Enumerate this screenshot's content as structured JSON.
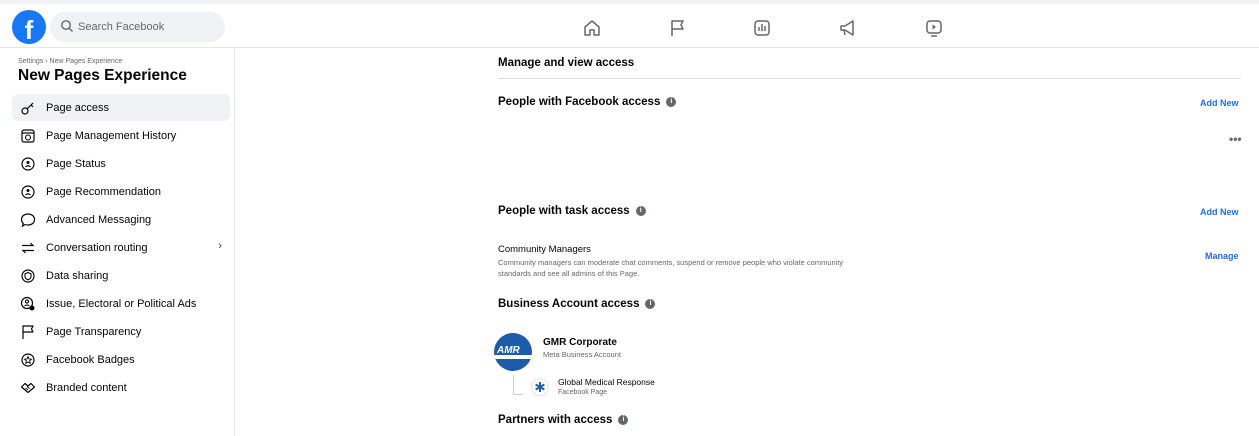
{
  "topbar": {
    "logo_letter": "f",
    "search_placeholder": "Search Facebook",
    "nav_icons": [
      "home-icon",
      "flag-icon",
      "insights-icon",
      "megaphone-icon",
      "video-icon"
    ]
  },
  "sidebar": {
    "breadcrumb": "Settings › New Pages Experience",
    "title": "New Pages Experience",
    "items": [
      {
        "label": "Page access",
        "icon": "key-icon",
        "active": true
      },
      {
        "label": "Page Management History",
        "icon": "history-icon"
      },
      {
        "label": "Page Status",
        "icon": "shield-icon"
      },
      {
        "label": "Page Recommendation",
        "icon": "shield-icon"
      },
      {
        "label": "Advanced Messaging",
        "icon": "chat-bubble-icon"
      },
      {
        "label": "Conversation routing",
        "icon": "arrows-icon",
        "chevron": "›"
      },
      {
        "label": "Data sharing",
        "icon": "shield-outline-icon"
      },
      {
        "label": "Issue, Electoral or Political Ads",
        "icon": "people-icon"
      },
      {
        "label": "Page Transparency",
        "icon": "flag-icon"
      },
      {
        "label": "Facebook Badges",
        "icon": "badge-icon"
      },
      {
        "label": "Branded content",
        "icon": "handshake-icon"
      }
    ]
  },
  "main": {
    "heading": "Manage and view access",
    "fb_access": {
      "title": "People with Facebook access",
      "add_label": "Add New",
      "more": "•••"
    },
    "task_access": {
      "title": "People with task access",
      "add_label": "Add New"
    },
    "community": {
      "title": "Community Managers",
      "desc": "Community managers can moderate chat comments, suspend or remove people who violate community standards and see all admins of this Page.",
      "manage_label": "Manage"
    },
    "business": {
      "title": "Business Account access",
      "account_name": "GMR Corporate",
      "account_type": "Meta Business Account",
      "logo_text": "AMR",
      "page_name": "Global Medical Response",
      "page_type": "Facebook Page"
    },
    "partners": {
      "title": "Partners with access"
    },
    "info_glyph": "i"
  }
}
